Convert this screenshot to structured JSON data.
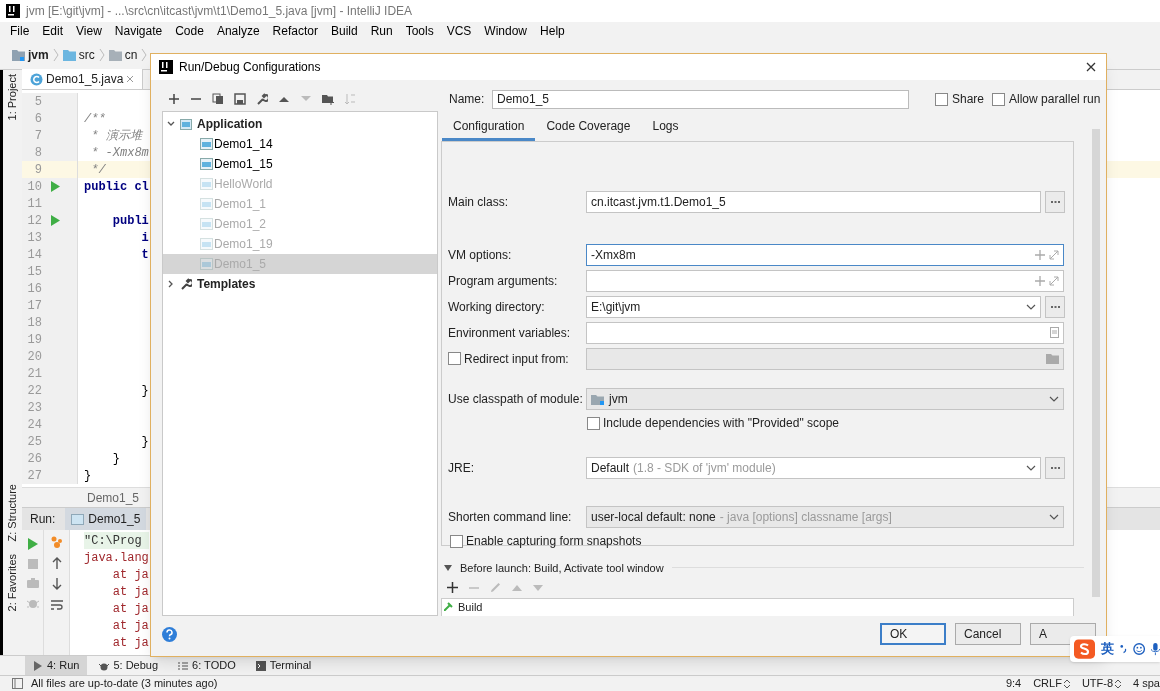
{
  "window": {
    "title": "jvm [E:\\git\\jvm] - ...\\src\\cn\\itcast\\jvm\\t1\\Demo1_5.java [jvm] - IntelliJ IDEA"
  },
  "menu": [
    "File",
    "Edit",
    "View",
    "Navigate",
    "Code",
    "Analyze",
    "Refactor",
    "Build",
    "Run",
    "Tools",
    "VCS",
    "Window",
    "Help"
  ],
  "breadcrumbs": [
    {
      "label": "jvm",
      "kind": "module"
    },
    {
      "label": "src",
      "kind": "folder"
    },
    {
      "label": "cn",
      "kind": "package"
    }
  ],
  "tool_strip": {
    "top": [
      "1: Project"
    ],
    "bottom": [
      "Z: Structure",
      "2: Favorites"
    ]
  },
  "editor_tab": {
    "label": "Demo1_5.java"
  },
  "editor": {
    "lines": [
      {
        "number": "5",
        "run": false,
        "highlighted": false
      },
      {
        "number": "6",
        "text": "/**",
        "kind": "comment",
        "run": false,
        "highlighted": false
      },
      {
        "number": "7",
        "text": " * 演示堆",
        "kind": "comment",
        "run": false,
        "highlighted": false
      },
      {
        "number": "8",
        "text": " * -Xmx8m",
        "kind": "comment",
        "run": false,
        "highlighted": false
      },
      {
        "number": "9",
        "text": " */",
        "kind": "comment",
        "run": false,
        "highlighted": true
      },
      {
        "number": "10",
        "text": "public cl",
        "kind": "keyword",
        "run": true,
        "highlighted": false
      },
      {
        "number": "11",
        "run": false,
        "highlighted": false
      },
      {
        "number": "12",
        "text": "    publi",
        "kind": "keyword",
        "run": true,
        "highlighted": false
      },
      {
        "number": "13",
        "text": "        i",
        "kind": "keyword",
        "run": false,
        "highlighted": false
      },
      {
        "number": "14",
        "text": "        t",
        "kind": "keyword",
        "run": false,
        "highlighted": false
      },
      {
        "number": "15",
        "run": false,
        "highlighted": false
      },
      {
        "number": "16",
        "run": false,
        "highlighted": false
      },
      {
        "number": "17",
        "run": false,
        "highlighted": false
      },
      {
        "number": "18",
        "run": false,
        "highlighted": false
      },
      {
        "number": "19",
        "run": false,
        "highlighted": false
      },
      {
        "number": "20",
        "run": false,
        "highlighted": false
      },
      {
        "number": "21",
        "run": false,
        "highlighted": false
      },
      {
        "number": "22",
        "text": "        }",
        "kind": "code",
        "run": false,
        "highlighted": false
      },
      {
        "number": "23",
        "run": false,
        "highlighted": false
      },
      {
        "number": "24",
        "run": false,
        "highlighted": false
      },
      {
        "number": "25",
        "text": "        }",
        "kind": "code",
        "run": false,
        "highlighted": false
      },
      {
        "number": "26",
        "text": "    }",
        "kind": "code",
        "run": false,
        "highlighted": false
      },
      {
        "number": "27",
        "text": "}",
        "kind": "code",
        "run": false,
        "highlighted": false
      }
    ],
    "breadcrumb": "Demo1_5"
  },
  "run_panel": {
    "label": "Run:",
    "tab": "Demo1_5",
    "console": [
      {
        "text": "\"C:\\Prog",
        "kind": "command"
      },
      {
        "text": "java.lang",
        "kind": "error"
      },
      {
        "text": "    at ja",
        "kind": "error"
      },
      {
        "text": "    at ja",
        "kind": "error"
      },
      {
        "text": "    at ja",
        "kind": "error"
      },
      {
        "text": "    at ja",
        "kind": "error"
      },
      {
        "text": "    at ja",
        "kind": "error"
      }
    ]
  },
  "tool_windows": [
    {
      "label": "4: Run",
      "kind": "run",
      "selected": true
    },
    {
      "label": "5: Debug",
      "kind": "debug",
      "selected": false
    },
    {
      "label": "6: TODO",
      "kind": "todo",
      "selected": false
    },
    {
      "label": "Terminal",
      "kind": "terminal",
      "selected": false
    }
  ],
  "status_bar": {
    "message": "All files are up-to-date (3 minutes ago)",
    "items": [
      {
        "text": "9:4",
        "switch": false
      },
      {
        "text": "CRLF",
        "switch": true
      },
      {
        "text": "UTF-8",
        "switch": true
      },
      {
        "text": "4 spa",
        "switch": false
      }
    ]
  },
  "dialog": {
    "title": "Run/Debug Configurations",
    "tree": [
      {
        "label": "Application",
        "expanded": true,
        "children": [
          {
            "label": "Demo1_14",
            "saved": true,
            "selected": false
          },
          {
            "label": "Demo1_15",
            "saved": true,
            "selected": false
          },
          {
            "label": "HelloWorld",
            "saved": false,
            "selected": false
          },
          {
            "label": "Demo1_1",
            "saved": false,
            "selected": false
          },
          {
            "label": "Demo1_2",
            "saved": false,
            "selected": false
          },
          {
            "label": "Demo1_19",
            "saved": false,
            "selected": false
          },
          {
            "label": "Demo1_5",
            "saved": false,
            "selected": true
          }
        ]
      },
      {
        "label": "Templates",
        "expanded": false
      }
    ],
    "name_label": "Name:",
    "name": "Demo1_5",
    "options": [
      {
        "label": "Share",
        "checked": false
      },
      {
        "label": "Allow parallel run",
        "checked": false
      }
    ],
    "tabs": [
      {
        "label": "Configuration",
        "selected": true
      },
      {
        "label": "Code Coverage",
        "selected": false
      },
      {
        "label": "Logs",
        "selected": false
      }
    ],
    "field_groups": [
      [
        {
          "kind": "text",
          "label": "Main class:",
          "value": "cn.itcast.jvm.t1.Demo1_5"
        }
      ],
      [
        {
          "kind": "expandable",
          "label": "VM options:",
          "value": "-Xmx8m",
          "focused": true
        },
        {
          "kind": "expandable",
          "label": "Program arguments:",
          "focused": false
        },
        {
          "kind": "dropdown",
          "label": "Working directory:",
          "value": "E:\\git\\jvm"
        },
        {
          "kind": "env",
          "label": "Environment variables:"
        },
        {
          "kind": "redirect",
          "label": "Redirect input from:",
          "checked": false
        }
      ],
      [
        {
          "kind": "module",
          "label": "Use classpath of module:",
          "value": "jvm"
        },
        {
          "kind": "sub_checkbox",
          "label": "Include dependencies with \"Provided\" scope",
          "checked": false
        }
      ],
      [
        {
          "kind": "jre",
          "label": "JRE:",
          "value": "Default",
          "hint": "(1.8 - SDK of 'jvm' module)"
        }
      ],
      [
        {
          "kind": "combo",
          "label": "Shorten command line:",
          "value": "user-local default: none",
          "hint": "- java [options] classname [args]"
        },
        {
          "kind": "checkbox",
          "label": "Enable capturing form snapshots",
          "checked": false
        }
      ]
    ],
    "before_launch": {
      "title": "Before launch: Build, Activate tool window",
      "expanded": true,
      "tasks": [
        "Build"
      ]
    },
    "buttons": [
      {
        "label": "OK",
        "primary": true
      },
      {
        "label": "Cancel",
        "primary": false
      },
      {
        "label": "A",
        "primary": false
      }
    ]
  },
  "ime_bar": {
    "mode": "英"
  }
}
